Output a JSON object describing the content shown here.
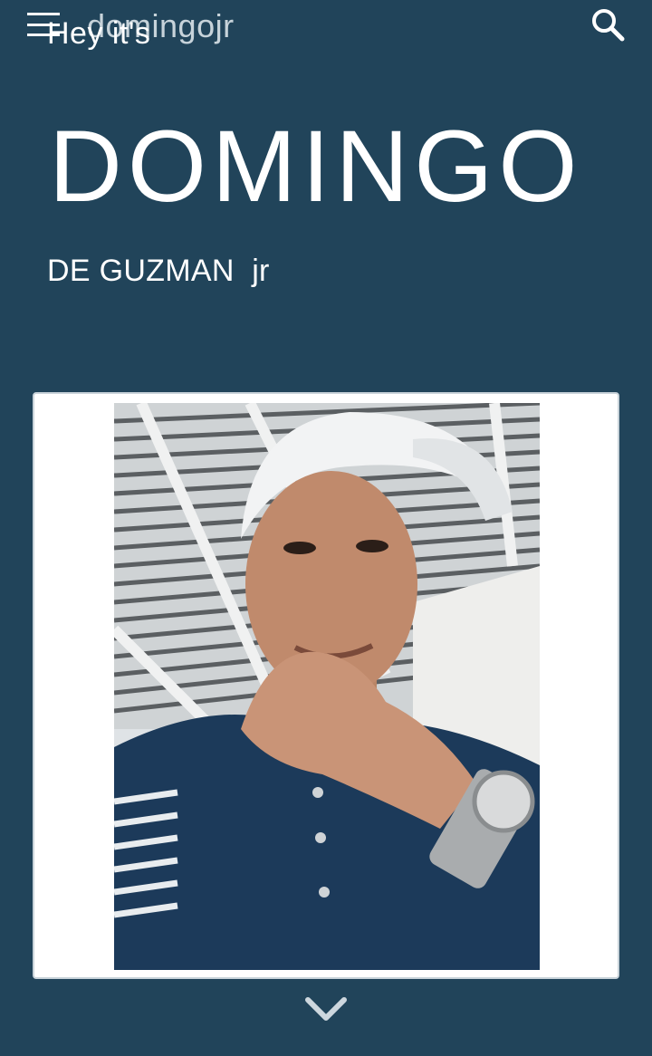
{
  "header": {
    "menu_icon": "hamburger-menu-icon",
    "site_title": "domingojr",
    "overlay_text": "Hey it's",
    "search_icon": "search-icon"
  },
  "hero": {
    "title": "DOMINGO",
    "subtitle": "DE GUZMAN  jr"
  },
  "photo": {
    "description_icon": "profile-photo"
  },
  "footer": {
    "scroll_icon": "chevron-down-icon"
  },
  "colors": {
    "background": "#21445a",
    "card": "#ffffff",
    "text": "#ffffff"
  }
}
